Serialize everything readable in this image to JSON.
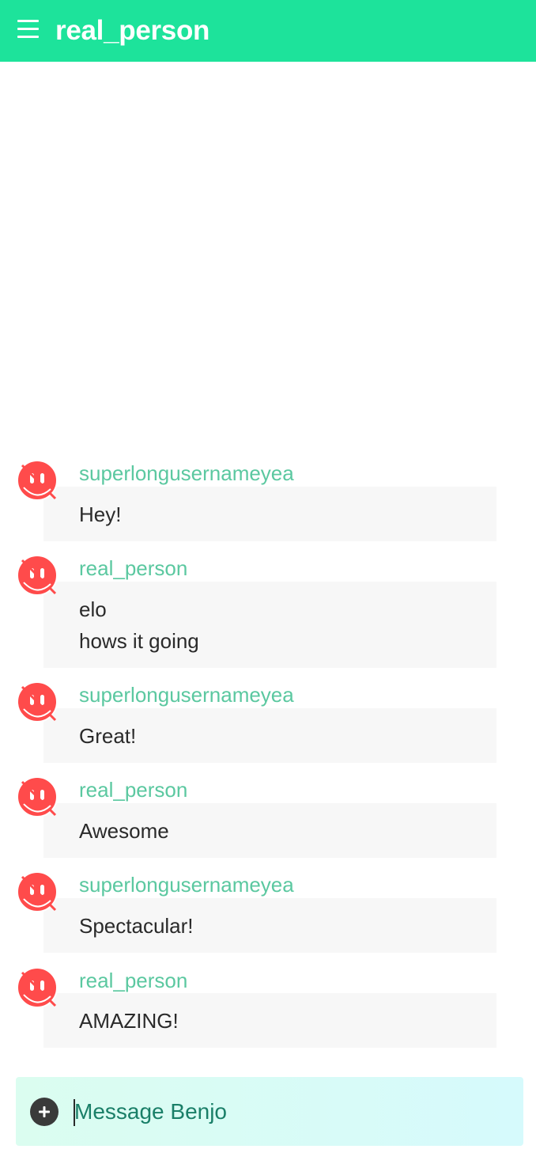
{
  "header": {
    "title": "real_person",
    "menu_icon": "hamburger-menu-icon",
    "background": "#1de39b"
  },
  "messages": [
    {
      "username": "superlongusernameyea",
      "lines": [
        "Hey!"
      ]
    },
    {
      "username": "real_person",
      "lines": [
        "elo",
        "hows it going"
      ]
    },
    {
      "username": "superlongusernameyea",
      "lines": [
        "Great!"
      ]
    },
    {
      "username": "real_person",
      "lines": [
        "Awesome"
      ]
    },
    {
      "username": "superlongusernameyea",
      "lines": [
        "Spectacular!"
      ]
    },
    {
      "username": "real_person",
      "lines": [
        "AMAZING!"
      ]
    }
  ],
  "avatar_icon": "red-smiley-avatar-icon",
  "composer": {
    "placeholder": "Message Benjo",
    "add_icon": "plus-circle-icon"
  },
  "colors": {
    "accent": "#1de39b",
    "username": "#5bc8a0",
    "avatar": "#ff4b4b",
    "bubble": "#f7f7f7"
  }
}
